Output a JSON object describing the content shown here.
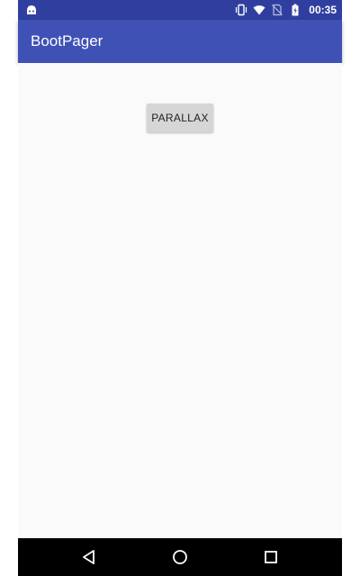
{
  "status_bar": {
    "time": "00:35",
    "icons": [
      "android-icon",
      "vibrate-icon",
      "wifi-icon",
      "no-sim-icon",
      "battery-icon"
    ]
  },
  "app_bar": {
    "title": "BootPager"
  },
  "main": {
    "parallax_button_label": "PARALLAX"
  },
  "nav_bar": {
    "icons": [
      "back-icon",
      "home-icon",
      "recents-icon"
    ]
  },
  "colors": {
    "status_bar": "#303f9f",
    "app_bar": "#3f51b5",
    "background": "#fafafa",
    "button": "#d6d6d6",
    "nav_bar": "#000000"
  }
}
